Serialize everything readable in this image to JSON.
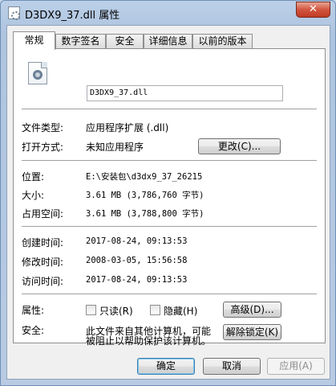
{
  "window": {
    "title": "D3DX9_37.dll 属性",
    "close_glyph": "✕"
  },
  "tabs": [
    {
      "label": "常规"
    },
    {
      "label": "数字签名"
    },
    {
      "label": "安全"
    },
    {
      "label": "详细信息"
    },
    {
      "label": "以前的版本"
    }
  ],
  "general": {
    "file_name": "D3DX9_37.dll",
    "file_type_label": "文件类型:",
    "file_type_value": "应用程序扩展 (.dll)",
    "opens_with_label": "打开方式:",
    "opens_with_value": "未知应用程序",
    "change_button": "更改(C)...",
    "location_label": "位置:",
    "location_value": "E:\\安装包\\d3dx9_37_26215",
    "size_label": "大小:",
    "size_value": "3.61 MB (3,786,760 字节)",
    "size_on_disk_label": "占用空间:",
    "size_on_disk_value": "3.61 MB (3,788,800 字节)",
    "created_label": "创建时间:",
    "created_value": "2017-08-24, 09:13:53",
    "modified_label": "修改时间:",
    "modified_value": "2008-03-05, 15:56:58",
    "accessed_label": "访问时间:",
    "accessed_value": "2017-08-24, 09:13:53",
    "attributes_label": "属性:",
    "readonly_label": "只读(R)",
    "readonly_checked": false,
    "hidden_label": "隐藏(H)",
    "hidden_checked": false,
    "advanced_button": "高级(D)...",
    "security_label": "安全:",
    "security_text_line1": "此文件来自其他计算机，可能",
    "security_text_line2": "被阻止以帮助保护该计算机。",
    "unblock_button": "解除锁定(K)"
  },
  "footer": {
    "ok_button": "确定",
    "cancel_button": "取消",
    "apply_button": "应用(A)"
  }
}
